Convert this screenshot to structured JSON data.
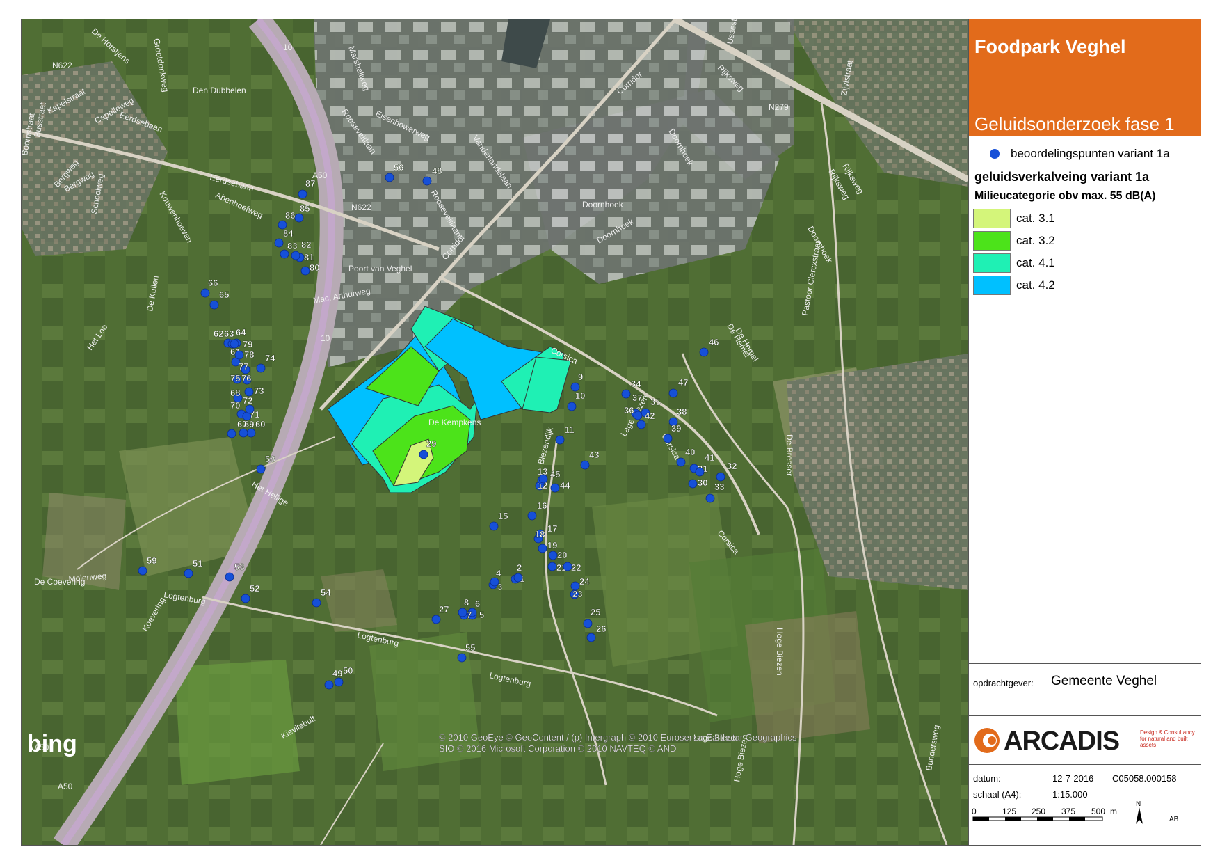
{
  "panel": {
    "title": "Foodpark Veghel",
    "subtitle": "Geluidsonderzoek fase 1",
    "legend_points_label": "beoordelingspunten variant 1a",
    "legend_heading": "geluidsverkalveing variant 1a",
    "legend_subheading": "Milieucategorie obv max. 55 dB(A)",
    "categories": [
      {
        "label": "cat. 3.1",
        "color": "#d4f57a"
      },
      {
        "label": "cat. 3.2",
        "color": "#4ce31a"
      },
      {
        "label": "cat. 4.1",
        "color": "#1ff0b4"
      },
      {
        "label": "cat. 4.2",
        "color": "#00c0ff"
      }
    ],
    "client_label": "opdrachtgever:",
    "client_value": "Gemeente Veghel",
    "logo_text": "ARCADIS",
    "logo_tagline": "Design & Consultancy for natural and built assets",
    "date_label": "datum:",
    "date_value": "12-7-2016",
    "project_code": "C05058.000158",
    "scale_label": "schaal (A4):",
    "scale_value": "1:15.000",
    "scalebar_ticks": [
      "0",
      "125",
      "250",
      "375",
      "500"
    ],
    "scalebar_unit": "m",
    "north_label": "N",
    "author": "AB"
  },
  "map": {
    "watermark": "bing",
    "copyright_line1": "© 2010 GeoEye © GeoContent / (p) Intergraph © 2010 Eurosense Earthstar Geographics",
    "copyright_line2": "SIO © 2016 Microsoft Corporation © 2010 NAVTEQ © AND",
    "point_color": "#1650d8",
    "road_labels": [
      "De Horstjens",
      "Grootdonkweg",
      "N622",
      "Eerdsebaan",
      "Den Dubbelen",
      "Eerdsebaan",
      "Abenhoefweg",
      "Bergweg",
      "Molenweg",
      "Logtenburg",
      "Logtenburg",
      "Logtenburg",
      "Kievitsbult",
      "Koevering",
      "De Coevering",
      "Het Hellige",
      "De Kullen",
      "Het Loo",
      "Mac. Arthurweg",
      "Poort van Veghel",
      "Corsica",
      "Corsica",
      "Corridor",
      "Corridor",
      "Rooseveltlaan",
      "Rooseveltlaan",
      "Eisenhowerweg",
      "Vanderlandelaan",
      "Marshallweg",
      "Doornhoek",
      "Doornhoek",
      "Doornhoek",
      "Rijksweg",
      "Rijksweg",
      "N279",
      "De Hemel",
      "De Hemel",
      "Doornhoek",
      "Hoge Biezen",
      "De Bresser",
      "Pastoor Clercxstraat",
      "Zijvistraat",
      "Bundersweg",
      "De Kempkens",
      "Biezendijk",
      "Lage Biezen",
      "A50",
      "A50",
      "A50",
      "10",
      "10",
      "N622",
      "Corsica",
      "Kapelstraat",
      "Capelleweg",
      "Boomstraat",
      "Busstraat",
      "Bergweg",
      "Schoolweg",
      "Kouwenhoeven",
      "Lage Biezen",
      "Hoge Biezen",
      "Ussestraat",
      "Rijksweg"
    ]
  },
  "points": [
    {
      "n": "1"
    },
    {
      "n": "2"
    },
    {
      "n": "3"
    },
    {
      "n": "4"
    },
    {
      "n": "5"
    },
    {
      "n": "6"
    },
    {
      "n": "7"
    },
    {
      "n": "8"
    },
    {
      "n": "9"
    },
    {
      "n": "10"
    },
    {
      "n": "11"
    },
    {
      "n": "12"
    },
    {
      "n": "13"
    },
    {
      "n": "15"
    },
    {
      "n": "16"
    },
    {
      "n": "17"
    },
    {
      "n": "18"
    },
    {
      "n": "19"
    },
    {
      "n": "20"
    },
    {
      "n": "21"
    },
    {
      "n": "22"
    },
    {
      "n": "23"
    },
    {
      "n": "24"
    },
    {
      "n": "25"
    },
    {
      "n": "26"
    },
    {
      "n": "27"
    },
    {
      "n": "29"
    },
    {
      "n": "30"
    },
    {
      "n": "31"
    },
    {
      "n": "32"
    },
    {
      "n": "33"
    },
    {
      "n": "34"
    },
    {
      "n": "35"
    },
    {
      "n": "36"
    },
    {
      "n": "37"
    },
    {
      "n": "38"
    },
    {
      "n": "39"
    },
    {
      "n": "40"
    },
    {
      "n": "41"
    },
    {
      "n": "42"
    },
    {
      "n": "43"
    },
    {
      "n": "44"
    },
    {
      "n": "45"
    },
    {
      "n": "46"
    },
    {
      "n": "47"
    },
    {
      "n": "48"
    },
    {
      "n": "49"
    },
    {
      "n": "50"
    },
    {
      "n": "51"
    },
    {
      "n": "52"
    },
    {
      "n": "53"
    },
    {
      "n": "54"
    },
    {
      "n": "55"
    },
    {
      "n": "56"
    },
    {
      "n": "58"
    },
    {
      "n": "59"
    },
    {
      "n": "60"
    },
    {
      "n": "61"
    },
    {
      "n": "62"
    },
    {
      "n": "63"
    },
    {
      "n": "64"
    },
    {
      "n": "65"
    },
    {
      "n": "66"
    },
    {
      "n": "67"
    },
    {
      "n": "68"
    },
    {
      "n": "69"
    },
    {
      "n": "70"
    },
    {
      "n": "71"
    },
    {
      "n": "72"
    },
    {
      "n": "73"
    },
    {
      "n": "74"
    },
    {
      "n": "75"
    },
    {
      "n": "76"
    },
    {
      "n": "77"
    },
    {
      "n": "78"
    },
    {
      "n": "79"
    },
    {
      "n": "80"
    },
    {
      "n": "81"
    },
    {
      "n": "82"
    },
    {
      "n": "83"
    },
    {
      "n": "84"
    },
    {
      "n": "85"
    },
    {
      "n": "86"
    },
    {
      "n": "87"
    }
  ]
}
